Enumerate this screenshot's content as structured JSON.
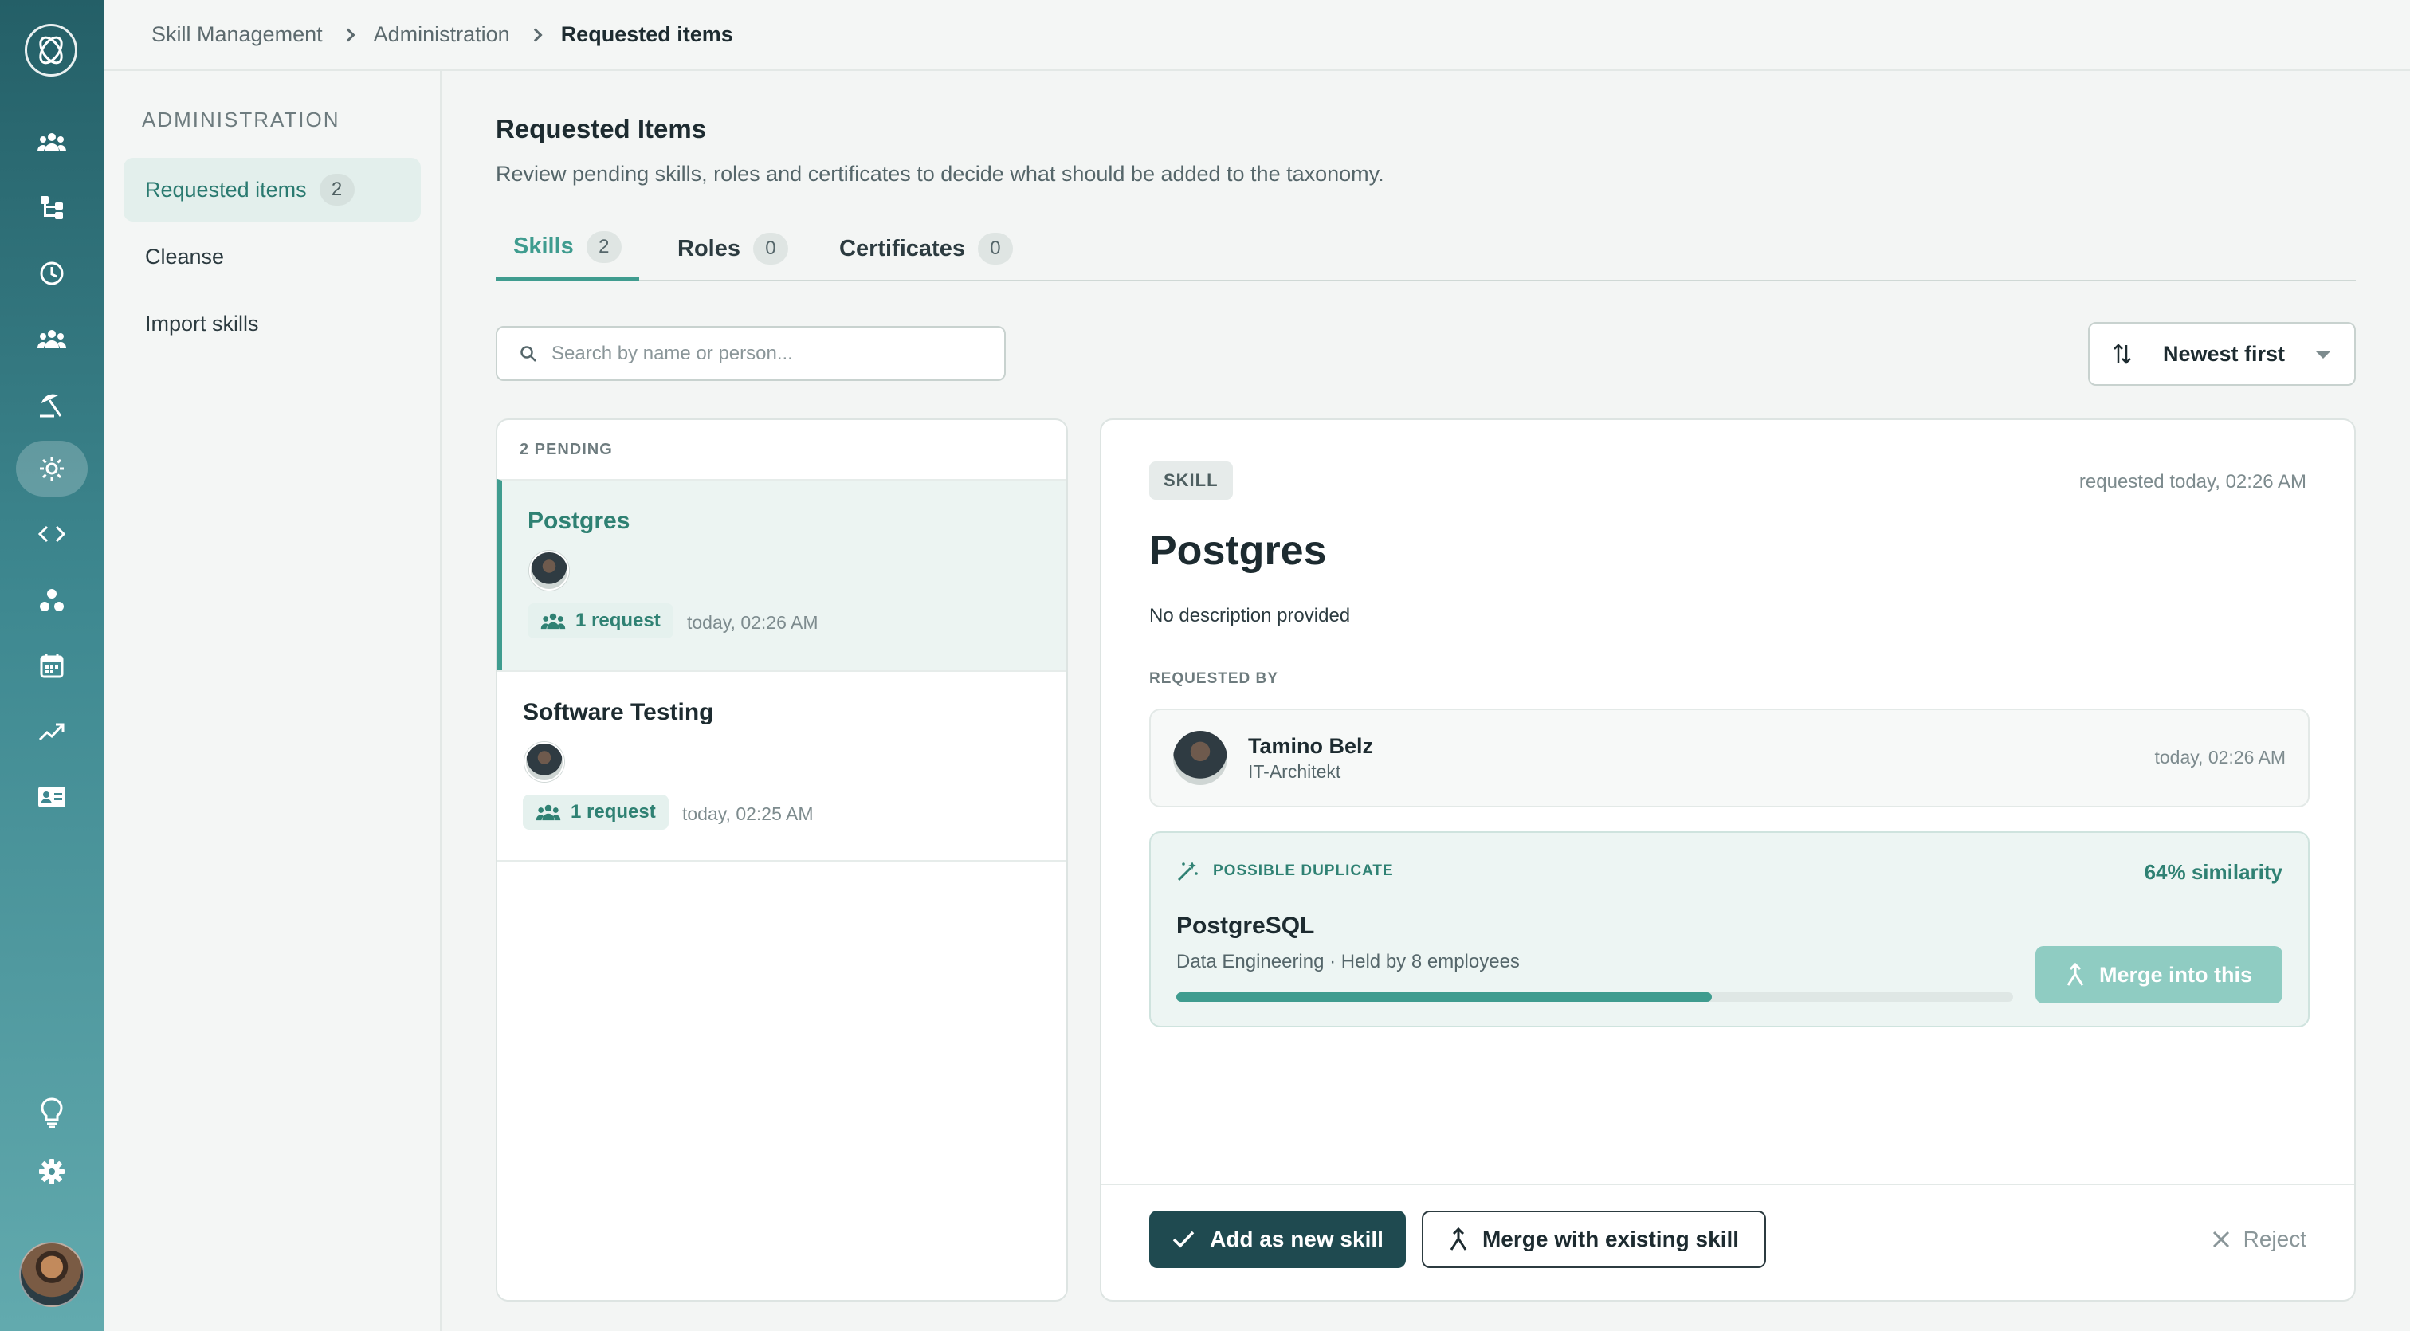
{
  "rail": {
    "icons": [
      "logo-icon",
      "people-icon",
      "org-chart-icon",
      "clock-icon",
      "team-icon",
      "beach-icon",
      "sun-icon",
      "code-icon",
      "circles-icon",
      "calendar-icon",
      "trend-icon",
      "id-card-icon",
      "lightbulb-icon",
      "gear-icon",
      "avatar"
    ]
  },
  "breadcrumb": {
    "items": [
      "Skill Management",
      "Administration",
      "Requested items"
    ]
  },
  "sidebar": {
    "heading": "ADMINISTRATION",
    "items": [
      {
        "label": "Requested items",
        "badge": "2"
      },
      {
        "label": "Cleanse"
      },
      {
        "label": "Import skills"
      }
    ]
  },
  "page": {
    "title": "Requested Items",
    "subtitle": "Review pending skills, roles and certificates to decide what should be added to the taxonomy."
  },
  "tabs": [
    {
      "label": "Skills",
      "count": "2"
    },
    {
      "label": "Roles",
      "count": "0"
    },
    {
      "label": "Certificates",
      "count": "0"
    }
  ],
  "search": {
    "placeholder": "Search by name or person...",
    "value": ""
  },
  "sort": {
    "label": "Newest first"
  },
  "list": {
    "pending_label": "2 PENDING",
    "items": [
      {
        "name": "Postgres",
        "requests": "1 request",
        "time": "today, 02:26 AM"
      },
      {
        "name": "Software Testing",
        "requests": "1 request",
        "time": "today, 02:25 AM"
      }
    ]
  },
  "detail": {
    "tag": "SKILL",
    "requested_at": "requested today, 02:26 AM",
    "name": "Postgres",
    "description": "No description provided",
    "requested_by_label": "REQUESTED BY",
    "requester": {
      "name": "Tamino Belz",
      "role": "IT-Architekt",
      "time": "today, 02:26 AM"
    },
    "duplicate": {
      "label": "POSSIBLE DUPLICATE",
      "similarity": "64% similarity",
      "similarity_value": 0.64,
      "name": "PostgreSQL",
      "meta": "Data Engineering · Held by 8 employees",
      "merge_label": "Merge into this"
    },
    "actions": {
      "add": "Add as new skill",
      "merge": "Merge with existing skill",
      "reject": "Reject"
    }
  },
  "colors": {
    "accent": "#3f9c8f",
    "primary_button": "#1f4a50",
    "rail_top": "#245f67",
    "rail_bottom": "#62aaae"
  }
}
